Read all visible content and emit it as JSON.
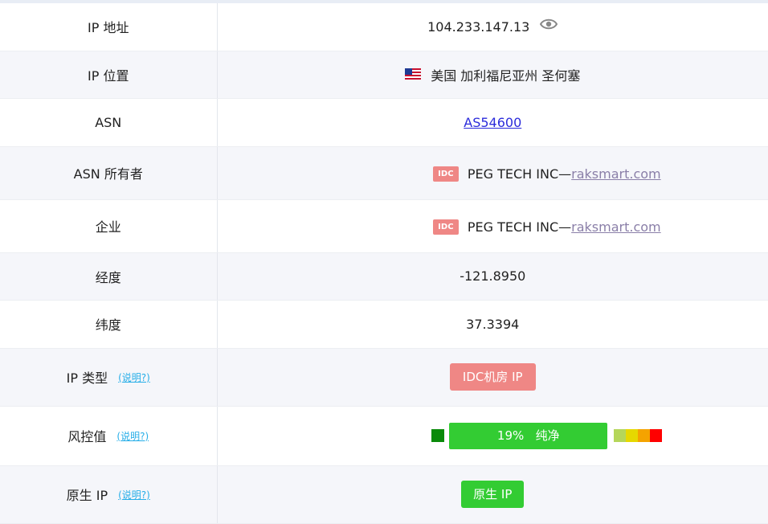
{
  "rows": {
    "ip_address": {
      "label": "IP 地址",
      "value": "104.233.147.13"
    },
    "ip_location": {
      "label": "IP 位置",
      "flag": "🇺🇸",
      "value": "美国 加利福尼亚州 圣何塞"
    },
    "asn": {
      "label": "ASN",
      "value": "AS54600"
    },
    "asn_owner": {
      "label": "ASN 所有者",
      "badge": "IDC",
      "name": "PEG TECH INC—",
      "domain": "raksmart.com"
    },
    "enterprise": {
      "label": "企业",
      "badge": "IDC",
      "name": "PEG TECH INC—",
      "domain": "raksmart.com"
    },
    "longitude": {
      "label": "经度",
      "value": "-121.8950"
    },
    "latitude": {
      "label": "纬度",
      "value": "37.3394"
    },
    "ip_type": {
      "label": "IP 类型",
      "explain": "(说明?)",
      "value": "IDC机房 IP"
    },
    "risk": {
      "label": "风控值",
      "explain": "(说明?)",
      "percent": "19%",
      "status": "纯净",
      "score": 0.19
    },
    "native_ip": {
      "label": "原生 IP",
      "explain": "(说明?)",
      "value": "原生 IP"
    }
  },
  "colors": {
    "idc_red": "#ef8785",
    "safe_green": "#33cc33",
    "dark_green": "#0a8a0a",
    "link_blue": "#2b2bdb",
    "explain_blue": "#27aee8",
    "scale": [
      "#b5d65a",
      "#e6d800",
      "#f5a300",
      "#ff0000"
    ]
  },
  "icons": {
    "eye": "eye-icon",
    "flag": "us-flag-icon"
  }
}
